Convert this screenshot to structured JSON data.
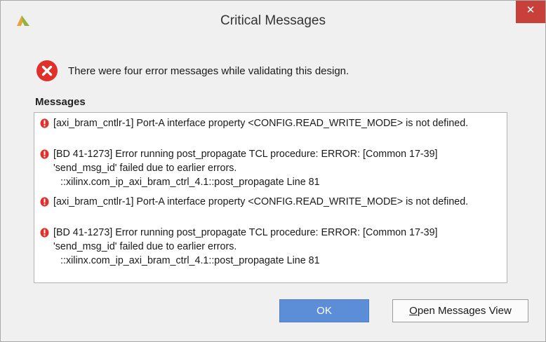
{
  "window": {
    "title": "Critical Messages",
    "close_label": "✕"
  },
  "header": {
    "text": "There were four error messages while validating this design."
  },
  "messages_label": "Messages",
  "messages": [
    {
      "lines": [
        "[axi_bram_cntlr-1] Port-A interface property <CONFIG.READ_WRITE_MODE> is not defined."
      ]
    },
    {
      "lines": [
        "[BD 41-1273] Error running post_propagate TCL procedure: ERROR: [Common 17-39]",
        "'send_msg_id' failed due to earlier errors.",
        "::xilinx.com_ip_axi_bram_ctrl_4.1::post_propagate Line 81"
      ]
    },
    {
      "lines": [
        "[axi_bram_cntlr-1] Port-A interface property <CONFIG.READ_WRITE_MODE> is not defined."
      ]
    },
    {
      "lines": [
        "[BD 41-1273] Error running post_propagate TCL procedure: ERROR: [Common 17-39]",
        "'send_msg_id' failed due to earlier errors.",
        "::xilinx.com_ip_axi_bram_ctrl_4.1::post_propagate Line 81"
      ]
    }
  ],
  "buttons": {
    "ok": "OK",
    "open_first": "O",
    "open_rest": "pen Messages View"
  },
  "colors": {
    "error_red": "#e0302a",
    "ok_blue": "#5b8ed6",
    "close_red": "#c7403a"
  },
  "icons": {
    "app": "vivado-logo-icon",
    "header": "error-icon",
    "bullet": "error-bullet-icon"
  }
}
